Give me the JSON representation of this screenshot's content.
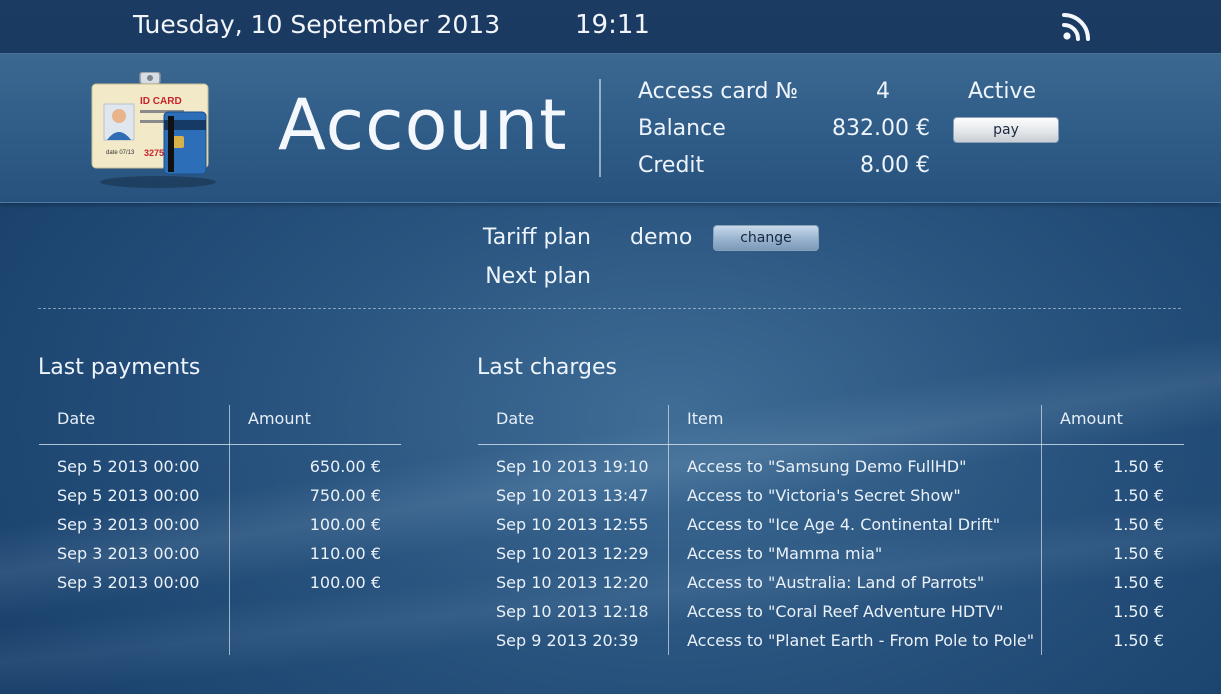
{
  "statusbar": {
    "date": "Tuesday, 10 September 2013",
    "time": "19:11",
    "icon": "rss-icon"
  },
  "header": {
    "title": "Account",
    "card_icon": "id-card-icon",
    "access_card_label": "Access card №",
    "access_card_number": "4",
    "access_card_status": "Active",
    "balance_label": "Balance",
    "balance_value": "832.00 €",
    "pay_button": "pay",
    "credit_label": "Credit",
    "credit_value": "8.00 €"
  },
  "plan": {
    "tariff_label": "Tariff plan",
    "tariff_value": "demo",
    "change_button": "change",
    "next_label": "Next plan"
  },
  "payments": {
    "title": "Last payments",
    "columns": [
      "Date",
      "Amount"
    ],
    "rows": [
      {
        "date": "Sep 5 2013 00:00",
        "amount": "650.00 €"
      },
      {
        "date": "Sep 5 2013 00:00",
        "amount": "750.00 €"
      },
      {
        "date": "Sep 3 2013 00:00",
        "amount": "100.00 €"
      },
      {
        "date": "Sep 3 2013 00:00",
        "amount": "110.00 €"
      },
      {
        "date": "Sep 3 2013 00:00",
        "amount": "100.00 €"
      }
    ]
  },
  "charges": {
    "title": "Last charges",
    "columns": [
      "Date",
      "Item",
      "Amount"
    ],
    "rows": [
      {
        "date": "Sep 10 2013 19:10",
        "item": "Access to \"Samsung Demo FullHD\"",
        "amount": "1.50 €"
      },
      {
        "date": "Sep 10 2013 13:47",
        "item": "Access to \"Victoria's Secret Show\"",
        "amount": "1.50 €"
      },
      {
        "date": "Sep 10 2013 12:55",
        "item": "Access to \"Ice Age 4. Continental Drift\"",
        "amount": "1.50 €"
      },
      {
        "date": "Sep 10 2013 12:29",
        "item": "Access to \"Mamma mia\"",
        "amount": "1.50 €"
      },
      {
        "date": "Sep 10 2013 12:20",
        "item": "Access to \"Australia: Land of Parrots\"",
        "amount": "1.50 €"
      },
      {
        "date": "Sep 10 2013 12:18",
        "item": "Access to \"Coral Reef Adventure HDTV\"",
        "amount": "1.50 €"
      },
      {
        "date": "Sep 9 2013 20:39",
        "item": "Access to \"Planet Earth - From Pole to Pole\"",
        "amount": "1.50 €"
      }
    ]
  }
}
